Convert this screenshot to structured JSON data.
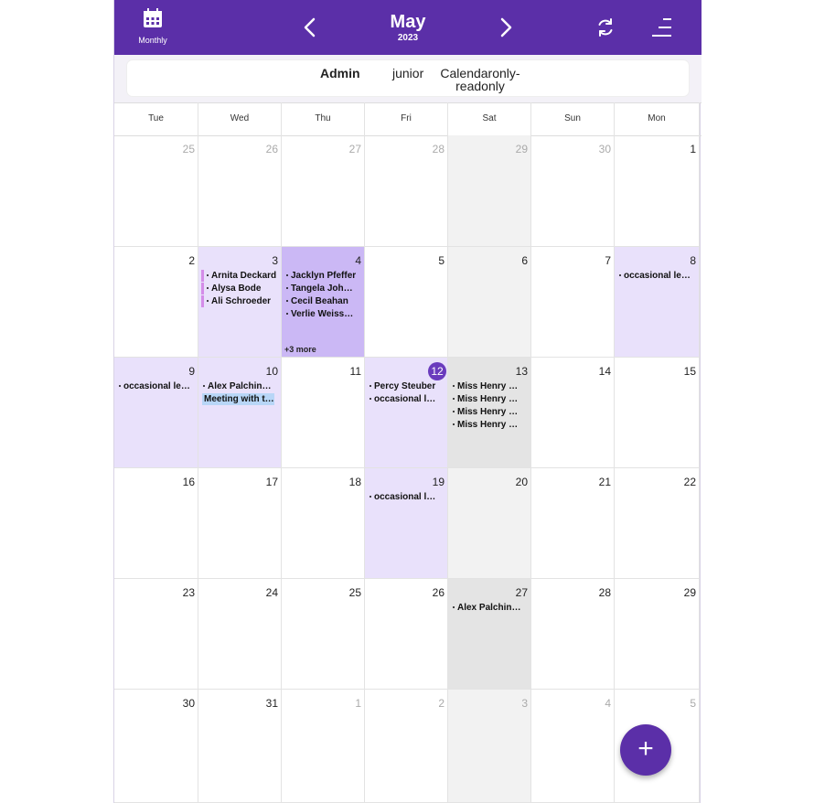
{
  "header": {
    "view_label": "Monthly",
    "month": "May",
    "year": "2023",
    "icons": {
      "view": "calendar-icon",
      "prev": "chevron-left-icon",
      "next": "chevron-right-icon",
      "refresh": "refresh-icon",
      "menu": "menu-icon"
    }
  },
  "calendars": {
    "tabs": [
      {
        "label": "Admin",
        "active": true
      },
      {
        "label": "junior",
        "active": false
      },
      {
        "label": "Calendaronly-readonly",
        "active": false
      }
    ]
  },
  "weekdays": [
    "Tue",
    "Wed",
    "Thu",
    "Fri",
    "Sat",
    "Sun",
    "Mon"
  ],
  "colors": {
    "primary": "#5b2fa8",
    "highlight_light": "#e9e1fb",
    "highlight_strong": "#cbb8f5",
    "weekend": "#f2f2f2",
    "weekend_dark": "#e4e4e4",
    "today": "#6a3bbd",
    "event_bar": "#d48ce8",
    "event_selected": "#b8d6f7"
  },
  "weeks": [
    [
      {
        "day": "25",
        "dim": true
      },
      {
        "day": "26",
        "dim": true
      },
      {
        "day": "27",
        "dim": true
      },
      {
        "day": "28",
        "dim": true
      },
      {
        "day": "29",
        "dim": true,
        "bg": "weekend"
      },
      {
        "day": "30",
        "dim": true
      },
      {
        "day": "1"
      }
    ],
    [
      {
        "day": "2"
      },
      {
        "day": "3",
        "bg": "highlight_light",
        "events": [
          {
            "title": "Arnita Deckard",
            "style": "bar"
          },
          {
            "title": "Alysa Bode",
            "style": "bar"
          },
          {
            "title": "Ali Schroeder",
            "style": "bar"
          }
        ]
      },
      {
        "day": "4",
        "bg": "highlight_strong",
        "events": [
          {
            "title": "Jacklyn Pfeffer"
          },
          {
            "title": "Tangela Johnson"
          },
          {
            "title": "Cecil Beahan"
          },
          {
            "title": "Verlie Weissnat"
          }
        ],
        "more": "+3 more"
      },
      {
        "day": "5"
      },
      {
        "day": "6",
        "bg": "weekend"
      },
      {
        "day": "7"
      },
      {
        "day": "8",
        "bg": "highlight_light",
        "events": [
          {
            "title": "occasional leave"
          }
        ]
      }
    ],
    [
      {
        "day": "9",
        "bg": "highlight_light",
        "events": [
          {
            "title": "occasional leave"
          }
        ]
      },
      {
        "day": "10",
        "bg": "highlight_light",
        "events": [
          {
            "title": "Alex Palchinsky"
          },
          {
            "title": "Meeting with team",
            "style": "hl"
          }
        ]
      },
      {
        "day": "11"
      },
      {
        "day": "12",
        "today": true,
        "bg": "highlight_light",
        "events": [
          {
            "title": "Percy Steuber"
          },
          {
            "title": "occasional leave"
          }
        ]
      },
      {
        "day": "13",
        "bg": "weekend_dark",
        "events": [
          {
            "title": "Miss Henry Kuhn"
          },
          {
            "title": "Miss Henry Kuhn"
          },
          {
            "title": "Miss Henry Kuhn"
          },
          {
            "title": "Miss Henry Kuhn"
          }
        ]
      },
      {
        "day": "14"
      },
      {
        "day": "15"
      }
    ],
    [
      {
        "day": "16"
      },
      {
        "day": "17"
      },
      {
        "day": "18"
      },
      {
        "day": "19",
        "bg": "highlight_light",
        "events": [
          {
            "title": "occasional leave"
          }
        ]
      },
      {
        "day": "20",
        "bg": "weekend"
      },
      {
        "day": "21"
      },
      {
        "day": "22"
      }
    ],
    [
      {
        "day": "23"
      },
      {
        "day": "24"
      },
      {
        "day": "25"
      },
      {
        "day": "26"
      },
      {
        "day": "27",
        "bg": "weekend_dark",
        "events": [
          {
            "title": "Alex Palchinsky"
          }
        ]
      },
      {
        "day": "28"
      },
      {
        "day": "29"
      }
    ],
    [
      {
        "day": "30"
      },
      {
        "day": "31"
      },
      {
        "day": "1",
        "dim": true
      },
      {
        "day": "2",
        "dim": true
      },
      {
        "day": "3",
        "dim": true,
        "bg": "weekend"
      },
      {
        "day": "4",
        "dim": true
      },
      {
        "day": "5",
        "dim": true
      }
    ]
  ],
  "fab": {
    "label": "+",
    "icon": "plus-icon"
  }
}
